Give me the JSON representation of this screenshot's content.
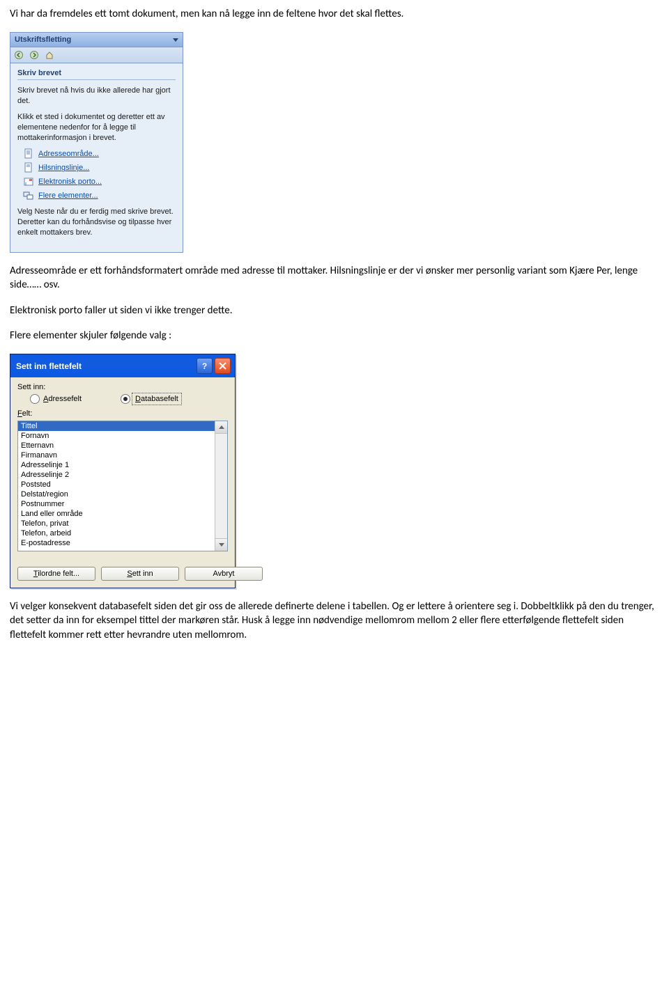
{
  "para1": "Vi har da fremdeles ett tomt dokument, men kan nå legge inn de feltene hvor det skal flettes.",
  "taskpane": {
    "title": "Utskriftsfletting",
    "section": "Skriv brevet",
    "text1": "Skriv brevet nå hvis du ikke allerede har gjort det.",
    "text2": "Klikk et sted i dokumentet og deretter ett av elementene nedenfor for å legge til mottakerinformasjon i brevet.",
    "links": {
      "address": "Adresseområde...",
      "greeting": "Hilsningslinje...",
      "epostage": "Elektronisk porto...",
      "more": "Flere elementer..."
    },
    "footer": "Velg Neste når du er ferdig med skrive brevet. Deretter kan du forhåndsvise og tilpasse hver enkelt mottakers brev."
  },
  "para2": "Adresseområde er ett forhåndsformatert område med adresse til mottaker. Hilsningslinje er der vi ønsker mer personlig variant som Kjære Per, lenge side…… osv.",
  "para3": "Elektronisk porto faller ut siden vi ikke trenger dette.",
  "para4": "Flere elementer skjuler følgende valg :",
  "dialog": {
    "title": "Sett inn flettefelt",
    "insert_label": "Sett inn:",
    "radio_address": "Adressefelt",
    "radio_db": "Databasefelt",
    "fields_label": "Felt:",
    "fields": [
      "Tittel",
      "Fornavn",
      "Etternavn",
      "Firmanavn",
      "Adresselinje 1",
      "Adresselinje 2",
      "Poststed",
      "Delstat/region",
      "Postnummer",
      "Land eller område",
      "Telefon, privat",
      "Telefon, arbeid",
      "E-postadresse"
    ],
    "buttons": {
      "assign": "Tilordne felt...",
      "insert": "Sett inn",
      "cancel": "Avbryt"
    }
  },
  "para5": "Vi velger konsekvent databasefelt siden det gir oss de allerede definerte delene i tabellen. Og er lettere å orientere seg i. Dobbeltklikk på den du trenger, det setter da inn for eksempel tittel der markøren står. Husk å legge inn nødvendige mellomrom mellom 2 eller flere etterfølgende flettefelt siden flettefelt kommer rett etter hevrandre uten mellomrom."
}
